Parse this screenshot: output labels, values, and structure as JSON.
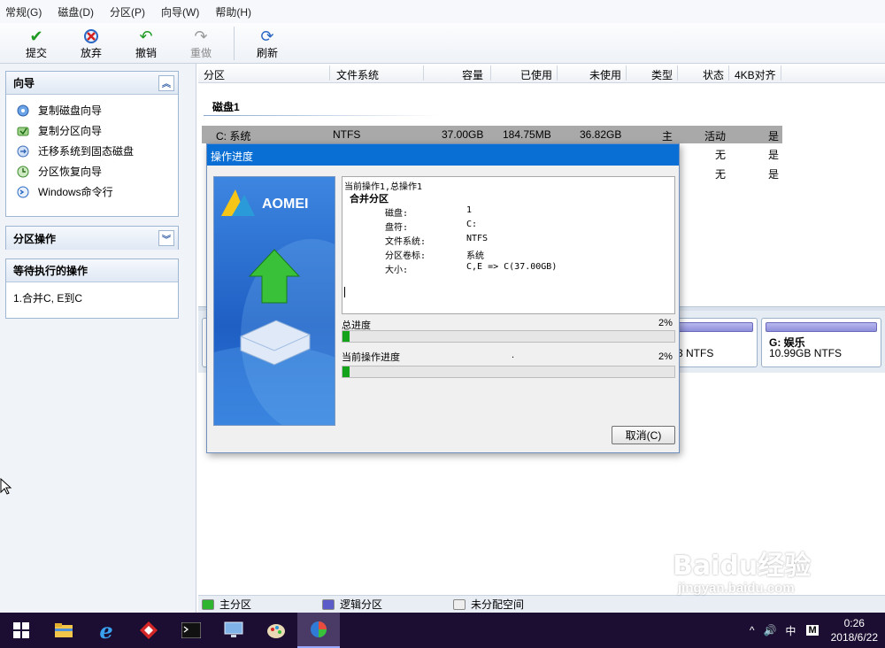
{
  "menu": [
    "常规(G)",
    "磁盘(D)",
    "分区(P)",
    "向导(W)",
    "帮助(H)"
  ],
  "toolbar": {
    "commit": "提交",
    "discard": "放弃",
    "undo": "撤销",
    "redo": "重做",
    "refresh": "刷新"
  },
  "left": {
    "wizard_title": "向导",
    "wizard_items": [
      "复制磁盘向导",
      "复制分区向导",
      "迁移系统到固态磁盘",
      "分区恢复向导",
      "Windows命令行"
    ],
    "partition_ops_title": "分区操作",
    "pending_title": "等待执行的操作",
    "pending_items": [
      "1.合并C, E到C"
    ]
  },
  "table": {
    "headers": [
      "分区",
      "文件系统",
      "容量",
      "已使用",
      "未使用",
      "类型",
      "状态",
      "4KB对齐"
    ],
    "disk_title": "磁盘1",
    "rows": [
      {
        "partition": "C: 系统",
        "fs": "NTFS",
        "capacity": "37.00GB",
        "used": "184.75MB",
        "free": "36.82GB",
        "type": "主",
        "status": "活动",
        "aligned": "是"
      },
      {
        "partition": "",
        "fs": "",
        "capacity": "",
        "used": "",
        "free": "",
        "type": "",
        "status": "无",
        "aligned": "是"
      },
      {
        "partition": "",
        "fs": "",
        "capacity": "",
        "used": "",
        "free": "",
        "type": "",
        "status": "无",
        "aligned": "是"
      }
    ]
  },
  "diskmap": {
    "partial_card": {
      "size": "3 NTFS"
    },
    "card_g": {
      "name": "G: 娱乐",
      "size": "10.99GB NTFS"
    }
  },
  "legend": {
    "primary": "主分区",
    "logical": "逻辑分区",
    "unallocated": "未分配空间",
    "colors": {
      "primary": "#2fb52f",
      "logical": "#5b5bc9",
      "unallocated": "#eeeeee"
    }
  },
  "dialog": {
    "title": "操作进度",
    "brand": "AOMEI",
    "log": {
      "current_op": "当前操作1,总操作1",
      "op_name": "合并分区",
      "fields": [
        {
          "label": "磁盘:",
          "value": "1"
        },
        {
          "label": "盘符:",
          "value": "C:"
        },
        {
          "label": "文件系统:",
          "value": "NTFS"
        },
        {
          "label": "分区卷标:",
          "value": "系统"
        },
        {
          "label": "大小:",
          "value": "C,E => C(37.00GB)"
        }
      ]
    },
    "total_label": "总进度",
    "total_pct": "2%",
    "total_fraction": 0.02,
    "current_label": "当前操作进度",
    "current_dot": ".",
    "current_pct": "2%",
    "current_fraction": 0.02,
    "cancel": "取消(C)"
  },
  "taskbar": {
    "tray_symbols": [
      "^",
      "🔊",
      "中",
      "M"
    ],
    "time": "0:26",
    "date": "2018/6/22"
  },
  "watermark": {
    "line1": "Baidu经验",
    "line2": "jingyan.baidu.com"
  }
}
